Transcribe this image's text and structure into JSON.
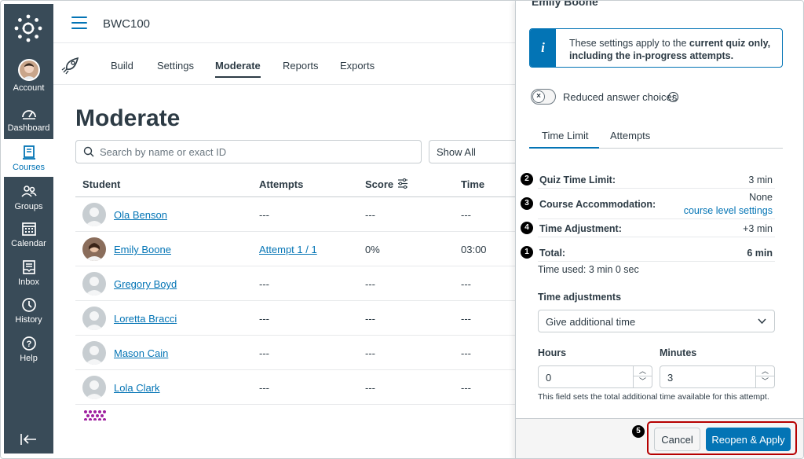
{
  "global_nav": {
    "items": [
      {
        "label": "Account",
        "icon": "avatar"
      },
      {
        "label": "Dashboard",
        "icon": "dashboard-icon"
      },
      {
        "label": "Courses",
        "icon": "courses-icon"
      },
      {
        "label": "Groups",
        "icon": "groups-icon"
      },
      {
        "label": "Calendar",
        "icon": "calendar-icon"
      },
      {
        "label": "Inbox",
        "icon": "inbox-icon"
      },
      {
        "label": "History",
        "icon": "history-icon"
      },
      {
        "label": "Help",
        "icon": "help-icon"
      }
    ]
  },
  "header": {
    "course": "BWC100"
  },
  "tabs": [
    "Build",
    "Settings",
    "Moderate",
    "Reports",
    "Exports"
  ],
  "main": {
    "title": "Moderate",
    "search_placeholder": "Search by name or exact ID",
    "filter": "Show All",
    "columns": [
      "Student",
      "Attempts",
      "Score",
      "Time"
    ],
    "rows": [
      {
        "name": "Ola Benson",
        "attempts": "---",
        "score": "---",
        "time": "---"
      },
      {
        "name": "Emily Boone",
        "attempts": "Attempt 1 / 1",
        "score": "0%",
        "time": "03:00"
      },
      {
        "name": "Gregory Boyd",
        "attempts": "---",
        "score": "---",
        "time": "---"
      },
      {
        "name": "Loretta Bracci",
        "attempts": "---",
        "score": "---",
        "time": "---"
      },
      {
        "name": "Mason Cain",
        "attempts": "---",
        "score": "---",
        "time": "---"
      },
      {
        "name": "Lola Clark",
        "attempts": "---",
        "score": "---",
        "time": "---"
      }
    ]
  },
  "tray": {
    "student": "Emily Boone",
    "alert_text_1": "These settings apply to the ",
    "alert_bold": "current quiz only, including the in-progress attempts.",
    "toggle_label": "Reduced answer choices",
    "tabs": [
      "Time Limit",
      "Attempts"
    ],
    "details": [
      {
        "badge": "2",
        "label": "Quiz Time Limit:",
        "value": "3 min"
      },
      {
        "badge": "3",
        "label": "Course Accommodation:",
        "value": "None",
        "link": "course level settings"
      },
      {
        "badge": "4",
        "label": "Time Adjustment:",
        "value": "+3 min"
      },
      {
        "badge": "1",
        "label": "Total:",
        "value": "6 min"
      }
    ],
    "time_used": "Time used: 3 min 0 sec",
    "adjust_label": "Time adjustments",
    "adjust_value": "Give additional time",
    "hours_label": "Hours",
    "hours_value": "0",
    "minutes_label": "Minutes",
    "minutes_value": "3",
    "hint": "This field sets the total additional time available for this attempt.",
    "footer_badge": "5",
    "cancel": "Cancel",
    "apply": "Reopen & Apply"
  },
  "colors": {
    "accent": "#0374b5",
    "nav": "#394b58",
    "highlight": "#b60000"
  }
}
